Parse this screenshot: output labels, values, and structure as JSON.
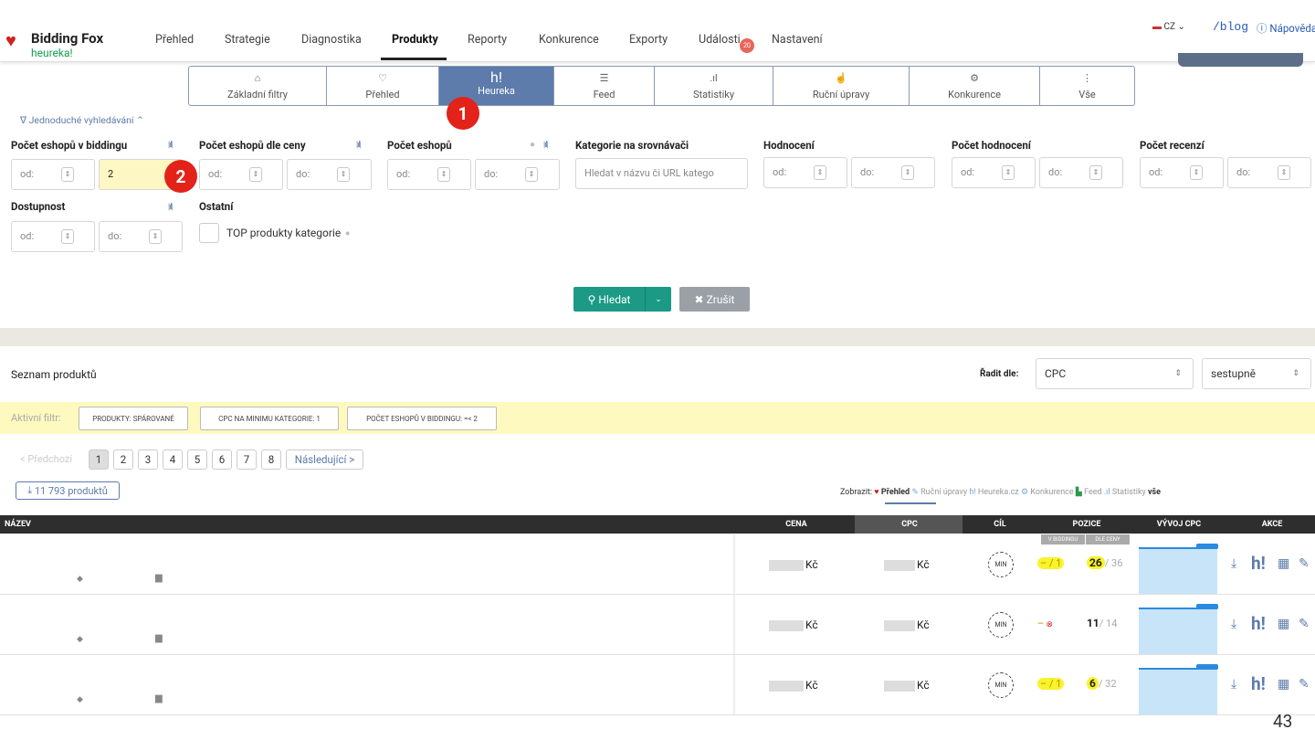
{
  "app": {
    "brand": "Bidding Fox",
    "sub": "heureka!",
    "lang": "CZ",
    "blog": "/blog",
    "help": "Nápověda"
  },
  "nav": [
    "Přehled",
    "Strategie",
    "Diagnostika",
    "Produkty",
    "Reporty",
    "Konkurence",
    "Exporty",
    "Události",
    "Nastavení"
  ],
  "events_badge": "20",
  "tabs": [
    {
      "label": "Základní filtry",
      "icon": "⌂"
    },
    {
      "label": "Přehled",
      "icon": "♡"
    },
    {
      "label": "Heureka",
      "icon": "h!"
    },
    {
      "label": "Feed",
      "icon": "☰"
    },
    {
      "label": "Statistiky",
      "icon": ".ıl"
    },
    {
      "label": "Ruční úpravy",
      "icon": "☝"
    },
    {
      "label": "Konkurence",
      "icon": "⚙"
    },
    {
      "label": "Vše",
      "icon": "⋮"
    }
  ],
  "callouts": [
    "1",
    "2"
  ],
  "filters": {
    "toggle": "∇ Jednoduché vyhledávání ⌃",
    "f1": "Počet eshopů v biddingu",
    "f2": "Počet eshopů dle ceny",
    "f3": "Počet eshopů",
    "f4": "Kategorie na srovnávači",
    "f5": "Hodnocení",
    "f6": "Počet hodnocení",
    "f7": "Počet recenzí",
    "f8": "Dostupnost",
    "f9": "Ostatní",
    "from": "od:",
    "to": "do:",
    "do_value": "2",
    "cat_placeholder": "Hledat v názvu či URL katego",
    "top": "TOP produkty kategorie",
    "search": "Hledat",
    "cancel": "Zrušit"
  },
  "list": {
    "title": "Seznam produktů",
    "sort_label": "Řadit dle:",
    "sort": "CPC",
    "order": "sestupně",
    "active_label": "Aktivní filtr:",
    "chips": [
      "PRODUKTY: SPÁROVANÉ",
      "CPC NA MINIMU KATEGORIE: 1",
      "POČET ESHOPŮ V BIDDINGU: =< 2"
    ],
    "prev": "< Předchozí",
    "pages": [
      "1",
      "2",
      "3",
      "4",
      "5",
      "6",
      "7",
      "8"
    ],
    "next": "Následující >",
    "count": "11 793 produktů",
    "show_label": "Zobrazit:",
    "views": [
      "Přehled",
      "Ruční úpravy",
      "Heureka.cz",
      "Konkurence",
      "Feed",
      "Statistiky",
      "vše"
    ]
  },
  "table": {
    "headers": [
      "NÁZEV",
      "CENA",
      "CPC",
      "CÍL",
      "POZICE",
      "VÝVOJ CPC",
      "AKCE"
    ],
    "sub1": "V BIDDINGU",
    "sub2": "DLE CENY",
    "currency": "Kč",
    "min": "MIN",
    "rows": [
      {
        "bid": "– / 1",
        "pos": "26",
        "tot": "/ 36"
      },
      {
        "bid": "–",
        "pos": "11",
        "tot": "/ 14"
      },
      {
        "bid": "– / 1",
        "pos": "6",
        "tot": "/ 32"
      }
    ]
  },
  "page_number": "43"
}
